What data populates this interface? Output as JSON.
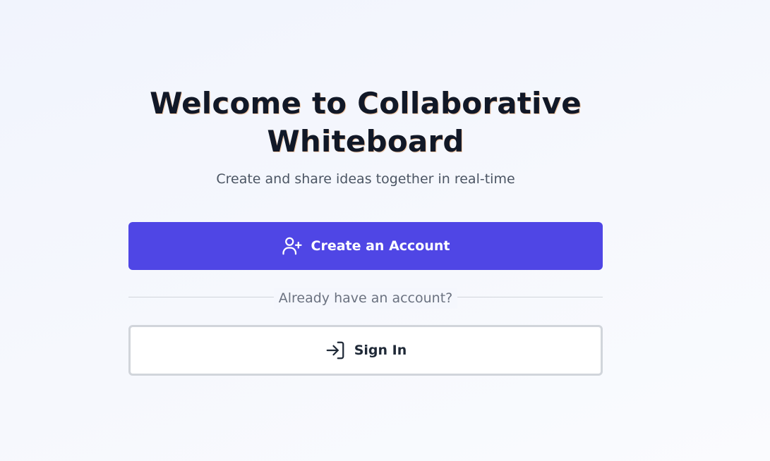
{
  "welcome": {
    "title": "Welcome to Collaborative Whiteboard",
    "subtitle": "Create and share ideas together in real-time"
  },
  "actions": {
    "create_account_label": "Create an Account",
    "create_account_icon": "user-plus-icon",
    "divider_text": "Already have an account?",
    "sign_in_label": "Sign In",
    "sign_in_icon": "log-in-icon"
  },
  "colors": {
    "primary": "#4f46e5",
    "title": "#111827",
    "subtitle": "#4b5563",
    "muted": "#6b7280",
    "border": "#d1d5db"
  }
}
